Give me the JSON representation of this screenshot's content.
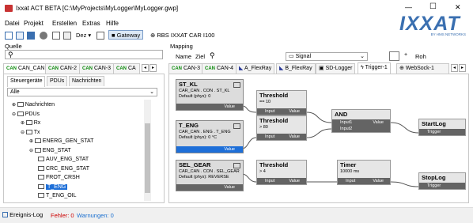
{
  "window": {
    "title": "Ixxat ACT BETA [C:\\MyProjects\\MyLogger\\MyLogger.gwp]",
    "min": "—",
    "max": "☐",
    "close": "✕"
  },
  "logo": {
    "text": "IXXAT",
    "sub": "BY HMS NETWORKS",
    "color": "#3a6fb0"
  },
  "menu": [
    "Datei",
    "Projekt",
    "Erstellen",
    "Extras",
    "Hilfe"
  ],
  "toolbar": {
    "dez": "Dez",
    "gateway": "Gateway",
    "rbs": "RBS IXXAT CAR I100"
  },
  "quelle": {
    "title": "Quelle",
    "tabs": [
      "CAN_CAN",
      "CAN-2",
      "CAN-3",
      "CA"
    ],
    "subtabs": [
      "Steuergeräte",
      "PDUs",
      "Nachrichten"
    ],
    "filter": "Alle",
    "tree": [
      {
        "label": "Nachrichten",
        "indent": 0
      },
      {
        "label": "PDUs",
        "indent": 0
      },
      {
        "label": "Rx",
        "indent": 1
      },
      {
        "label": "Tx",
        "indent": 1
      },
      {
        "label": "ENERG_GEN_STAT",
        "indent": 2
      },
      {
        "label": "ENG_STAT",
        "indent": 2
      },
      {
        "label": "AUV_ENG_STAT",
        "indent": 3
      },
      {
        "label": "CRC_ENG_STAT",
        "indent": 3
      },
      {
        "label": "FROT_CRSH",
        "indent": 3
      },
      {
        "label": "T_ENG",
        "indent": 3,
        "selected": true
      },
      {
        "label": "T_ENG_OIL",
        "indent": 3
      }
    ]
  },
  "mapping": {
    "title": "Mapping",
    "name_label": "Name",
    "ziel_label": "Ziel",
    "signal": "Signal",
    "roh": "Roh",
    "tabs": [
      "CAN-3",
      "CAN-4",
      "A_FlexRay",
      "B_FlexRay",
      "SD-Logger",
      "Trigger-1",
      "WebSock-1"
    ]
  },
  "nodes": {
    "st_kl": {
      "title": "ST_KL",
      "line1": "CAR_CAN . CON . ST_KL",
      "line2": "Default (phys): 0",
      "port": "Value"
    },
    "t_eng": {
      "title": "T_ENG",
      "line1": "CAR_CAN . ENG . T_ENG",
      "line2": "Default (phys): 0 °C",
      "port": "Value"
    },
    "sel_gear": {
      "title": "SEL_GEAR",
      "line1": "CAR_CAN . CON . SEL_GEAR",
      "line2": "Default (phys): REVERSE",
      "port": "Value"
    },
    "th1": {
      "title": "Threshold",
      "cond": "== 10",
      "in": "Input",
      "out": "Value"
    },
    "th2": {
      "title": "Threshold",
      "cond": "> 80",
      "in": "Input",
      "out": "Value"
    },
    "th3": {
      "title": "Threshold",
      "cond": "> 4",
      "in": "Input",
      "out": "Value"
    },
    "and": {
      "title": "AND",
      "in1": "Input1",
      "in2": "Input2",
      "out": "Value"
    },
    "timer": {
      "title": "Timer",
      "cond": "10000 ms",
      "in": "Input",
      "out": "Value"
    },
    "startlog": {
      "title": "StartLog",
      "in": "Trigger"
    },
    "stoplog": {
      "title": "StopLog",
      "in": "Trigger"
    }
  },
  "status": {
    "log": "Ereignis-Log",
    "errors": "Fehler: 0",
    "warnings": "Warnungen: 0"
  }
}
